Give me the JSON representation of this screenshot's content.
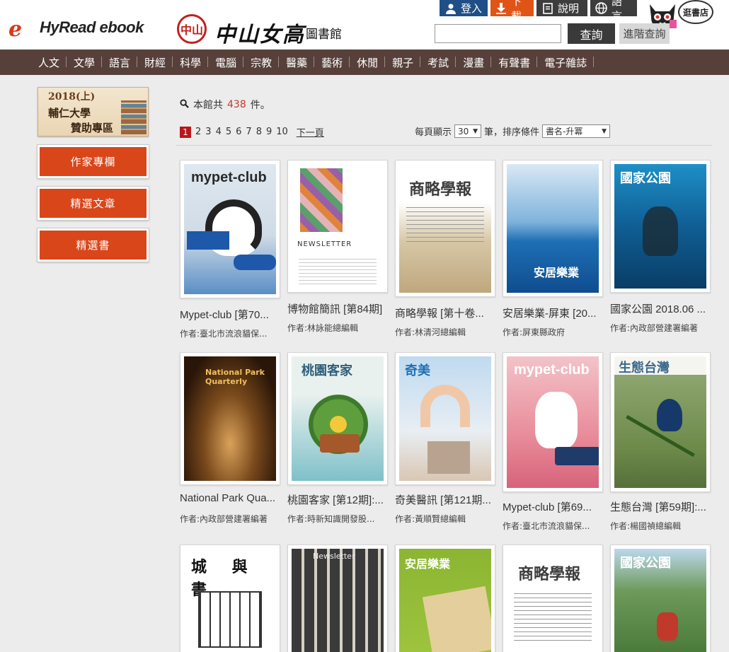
{
  "brand": {
    "logo_e": "e",
    "logo_text": "HyRead ebook",
    "seal": "中山",
    "school_name": "中山女高",
    "library_label": "圖書館"
  },
  "top_buttons": [
    {
      "label": "登入",
      "icon": "user-icon"
    },
    {
      "label": "下載",
      "icon": "download-icon"
    },
    {
      "label": "說明",
      "icon": "document-icon"
    },
    {
      "label": "語言",
      "icon": "globe-icon"
    }
  ],
  "mascot_bubble": "逛書店",
  "search": {
    "value": "",
    "placeholder": "",
    "button": "查詢",
    "advanced": "進階查詢"
  },
  "nav": [
    "人文",
    "文學",
    "語言",
    "財經",
    "科學",
    "電腦",
    "宗教",
    "醫藥",
    "藝術",
    "休閒",
    "親子",
    "考試",
    "漫畫",
    "有聲書",
    "電子雜誌"
  ],
  "sidebar": {
    "promo": {
      "year": "2018(上)",
      "line1": "輔仁大學",
      "line2": "贊助專區"
    },
    "buttons": [
      "作家專欄",
      "精選文章",
      "精選書"
    ]
  },
  "results": {
    "prefix": "本館共",
    "count": "438",
    "suffix": "件。"
  },
  "pager": {
    "pages": [
      "1",
      "2",
      "3",
      "4",
      "5",
      "6",
      "7",
      "8",
      "9",
      "10"
    ],
    "current": "1",
    "next": "下一頁"
  },
  "options": {
    "per_page_label": "每頁顯示",
    "per_page": "30",
    "per_page_unit": "筆，排序條件",
    "sort": "書名-升冪"
  },
  "books": [
    {
      "title": "Mypet-club [第70...",
      "author": "作者:臺北市流浪貓保...",
      "cover_text": "mypet-club"
    },
    {
      "title": "博物館簡訊 [第84期]",
      "author": "作者:林詠能總編輯",
      "cover_text": "NEWSLETTER"
    },
    {
      "title": "商略學報 [第十卷...",
      "author": "作者:林清河總編輯",
      "cover_text": "商略學報"
    },
    {
      "title": "安居樂業-屏東 [20...",
      "author": "作者:屏東縣政府",
      "cover_text": "安居樂業"
    },
    {
      "title": "國家公園 2018.06 ...",
      "author": "作者:內政部營建署編著",
      "cover_text": "國家公園"
    },
    {
      "title": "National Park Qua...",
      "author": "作者:內政部營建署編著",
      "cover_text": "National Park Quarterly"
    },
    {
      "title": "桃園客家 [第12期]:...",
      "author": "作者:時新知識開發股...",
      "cover_text": "桃園客家"
    },
    {
      "title": "奇美醫訊 [第121期...",
      "author": "作者:黃順賢總編輯",
      "cover_text": "奇美"
    },
    {
      "title": "Mypet-club [第69...",
      "author": "作者:臺北市流浪貓保...",
      "cover_text": "mypet-club"
    },
    {
      "title": "生態台灣 [第59期]:...",
      "author": "作者:楊國禎總編輯",
      "cover_text": "生態台灣"
    },
    {
      "title": "",
      "author": "",
      "cover_text": "城 與 書"
    },
    {
      "title": "",
      "author": "",
      "cover_text": "Newsletter"
    },
    {
      "title": "",
      "author": "",
      "cover_text": "安居樂業"
    },
    {
      "title": "",
      "author": "",
      "cover_text": "商略學報"
    },
    {
      "title": "",
      "author": "",
      "cover_text": "國家公園"
    }
  ]
}
